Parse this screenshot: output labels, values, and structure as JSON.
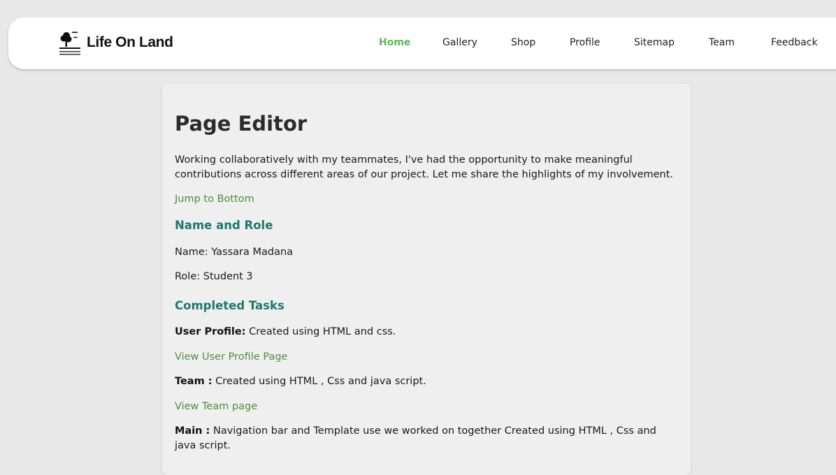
{
  "brand": {
    "name": "Life On Land",
    "logo_icon": "tree-logo-icon"
  },
  "nav": {
    "items": [
      {
        "label": "Home",
        "active": true
      },
      {
        "label": "Gallery",
        "active": false
      },
      {
        "label": "Shop",
        "active": false
      },
      {
        "label": "Profile",
        "active": false
      },
      {
        "label": "Sitemap",
        "active": false
      },
      {
        "label": "Team",
        "active": false
      },
      {
        "label": "Feedback",
        "active": false
      }
    ],
    "active_color": "#5cb85c"
  },
  "content": {
    "title": "Page Editor",
    "intro": "Working collaboratively with my teammates, I've had the opportunity to make meaningful contributions across different areas of our project. Let me share the highlights of my involvement.",
    "jump_link": "Jump to Bottom",
    "name_role_heading": "Name and Role",
    "name_line": "Name: Yassara Madana",
    "role_line": "Role: Student 3",
    "tasks_heading": "Completed Tasks",
    "tasks": [
      {
        "label": "User Profile:",
        "text": " Created using HTML and css.",
        "link": "View User Profile Page"
      },
      {
        "label": "Team :",
        "text": " Created using HTML , Css and java script.",
        "link": "View Team page"
      },
      {
        "label": "Main :",
        "text": " Navigation bar and Template use we worked on together Created using HTML , Css and java script."
      }
    ],
    "colors": {
      "heading": "#1b7a6e",
      "link": "#4e8f3a"
    }
  }
}
